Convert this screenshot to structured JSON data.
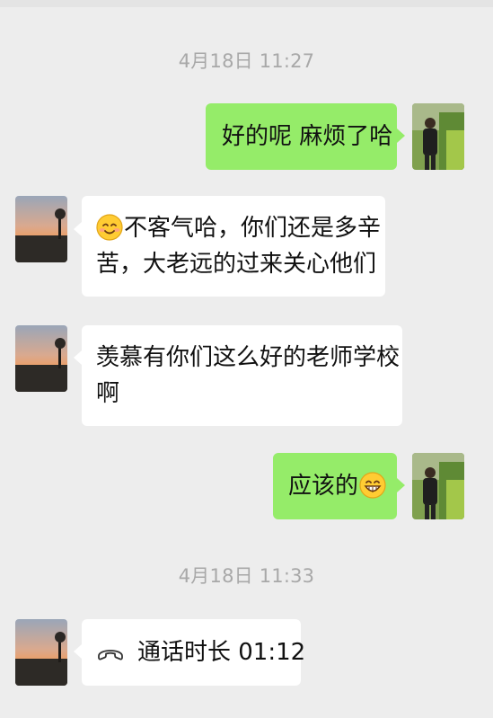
{
  "chat": {
    "timestamp_1": "4月18日 11:27",
    "timestamp_2": "4月18日 11:33",
    "messages": [
      {
        "sender": "me",
        "text": "好的呢 麻烦了哈"
      },
      {
        "sender": "other",
        "emoji": "smile-emoji",
        "lines": [
          "不客气哈，你们还是多辛",
          "苦，大老远的过来关心他们"
        ]
      },
      {
        "sender": "other",
        "lines": [
          "羡慕有你们这么好的老师学校",
          "啊"
        ]
      },
      {
        "sender": "me",
        "text": "应该的",
        "emoji": "grin-emoji"
      },
      {
        "sender": "other",
        "type": "call",
        "icon": "phone-hangup-icon",
        "text": "通话时长 01:12"
      }
    ]
  },
  "colors": {
    "background": "#ededed",
    "outgoing_bubble": "#95ec69",
    "incoming_bubble": "#ffffff",
    "timestamp_text": "#a8a8a8"
  }
}
